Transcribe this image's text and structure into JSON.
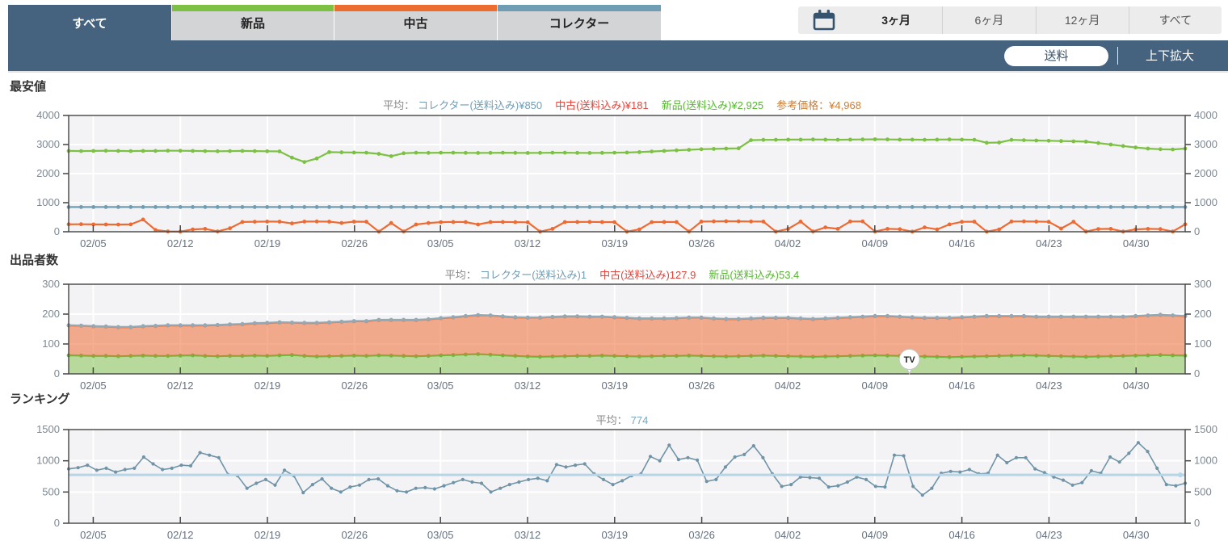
{
  "tabs": {
    "items": [
      {
        "label": "すべて",
        "selected": true,
        "stripe": ""
      },
      {
        "label": "新品",
        "selected": false,
        "stripe": "#7CC144"
      },
      {
        "label": "中古",
        "selected": false,
        "stripe": "#ED6C30"
      },
      {
        "label": "コレクター",
        "selected": false,
        "stripe": "#6F9DB4"
      }
    ]
  },
  "range_bar": {
    "calendar_icon": "calendar-icon",
    "items": [
      {
        "label": "3ヶ月",
        "selected": true
      },
      {
        "label": "6ヶ月",
        "selected": false
      },
      {
        "label": "12ヶ月",
        "selected": false
      },
      {
        "label": "すべて",
        "selected": false
      }
    ]
  },
  "toolbar": {
    "shipping_label": "送料",
    "expand_label": "上下拡大"
  },
  "colors": {
    "header": "#45637F",
    "new": "#7CC144",
    "used": "#ED6B33",
    "collector": "#6F9DB4",
    "ranking": "#7094A7",
    "avg_line": "#B5D6E8",
    "plot_bg": "#f3f3f5"
  },
  "sections": [
    {
      "title": "最安値",
      "avg": {
        "prefix": "平均：",
        "segments": [
          {
            "text": "コレクター(送料込み)¥850",
            "color": "#6F9DB4"
          },
          {
            "text": "中古(送料込み)¥181",
            "color": "#E2453C"
          },
          {
            "text": "新品(送料込み)¥2,925",
            "color": "#55B82E"
          },
          {
            "text": "参考価格：¥4,968",
            "color": "#C9803E"
          }
        ]
      }
    },
    {
      "title": "出品者数",
      "avg": {
        "prefix": "平均：",
        "segments": [
          {
            "text": "コレクター(送料込み)1",
            "color": "#6F9DB4"
          },
          {
            "text": "中古(送料込み)127.9",
            "color": "#E2453C"
          },
          {
            "text": "新品(送料込み)53.4",
            "color": "#55B82E"
          }
        ]
      }
    },
    {
      "title": "ランキング",
      "avg": {
        "prefix": "平均：",
        "segments": [
          {
            "text": "774",
            "color": "#7BA7C0"
          }
        ]
      }
    }
  ],
  "x_ticks": [
    {
      "label": "02/05",
      "f": 0.022
    },
    {
      "label": "02/12",
      "f": 0.1
    },
    {
      "label": "02/19",
      "f": 0.178
    },
    {
      "label": "02/26",
      "f": 0.256
    },
    {
      "label": "03/05",
      "f": 0.333
    },
    {
      "label": "03/12",
      "f": 0.411
    },
    {
      "label": "03/19",
      "f": 0.489
    },
    {
      "label": "03/26",
      "f": 0.567
    },
    {
      "label": "04/02",
      "f": 0.644
    },
    {
      "label": "04/09",
      "f": 0.722
    },
    {
      "label": "04/16",
      "f": 0.8
    },
    {
      "label": "04/23",
      "f": 0.878
    },
    {
      "label": "04/30",
      "f": 0.956
    }
  ],
  "chart_data": [
    {
      "type": "line",
      "title": "最安値",
      "ymax": 4000,
      "y_ticks": [
        0,
        1000,
        2000,
        3000,
        4000
      ],
      "x_range": [
        "02/03",
        "05/03"
      ],
      "grid": true,
      "series": [
        {
          "name": "新品(送料込み)",
          "color": "#7CC144",
          "values": [
            2780,
            2775,
            2780,
            2785,
            2780,
            2775,
            2780,
            2780,
            2790,
            2785,
            2780,
            2775,
            2770,
            2775,
            2780,
            2775,
            2770,
            2765,
            2550,
            2400,
            2520,
            2740,
            2730,
            2725,
            2720,
            2680,
            2600,
            2700,
            2720,
            2715,
            2720,
            2720,
            2715,
            2710,
            2715,
            2720,
            2715,
            2710,
            2715,
            2720,
            2720,
            2715,
            2710,
            2715,
            2720,
            2725,
            2740,
            2760,
            2780,
            2800,
            2820,
            2840,
            2850,
            2860,
            2870,
            3150,
            3160,
            3165,
            3170,
            3170,
            3175,
            3170,
            3165,
            3170,
            3175,
            3180,
            3175,
            3170,
            3170,
            3165,
            3170,
            3175,
            3170,
            3165,
            3060,
            3070,
            3160,
            3150,
            3140,
            3130,
            3120,
            3110,
            3100,
            3050,
            3000,
            2950,
            2900,
            2860,
            2840,
            2830,
            2860
          ]
        },
        {
          "name": "コレクター(送料込み)",
          "color": "#6F9DB4",
          "constant": 850,
          "points": 91
        },
        {
          "name": "中古(送料込み)",
          "color": "#ED6B33",
          "values": [
            255,
            258,
            252,
            250,
            248,
            252,
            420,
            60,
            10,
            5,
            80,
            100,
            10,
            120,
            335,
            345,
            350,
            348,
            285,
            350,
            352,
            348,
            300,
            348,
            345,
            5,
            300,
            10,
            250,
            300,
            330,
            335,
            332,
            250,
            332,
            336,
            330,
            325,
            5,
            100,
            332,
            336,
            340,
            334,
            330,
            5,
            80,
            330,
            336,
            332,
            8,
            350,
            356,
            360,
            358,
            354,
            350,
            5,
            100,
            350,
            10,
            150,
            100,
            352,
            356,
            8,
            100,
            90,
            5,
            150,
            80,
            252,
            342,
            346,
            5,
            80,
            352,
            356,
            350,
            342,
            110,
            345,
            8,
            95,
            100,
            8,
            80,
            100,
            92,
            8,
            255
          ]
        }
      ]
    },
    {
      "type": "stacked-area",
      "title": "出品者数",
      "ymax": 300,
      "y_ticks": [
        0,
        100,
        200,
        300
      ],
      "x_range": [
        "02/03",
        "05/03"
      ],
      "grid": true,
      "marker": {
        "label": "TV",
        "f": 0.753,
        "value": 62
      },
      "series": [
        {
          "name": "新品(送料込み)",
          "color": "#6DBB3C",
          "fill": "rgba(124,193,68,0.5)",
          "stacked": true,
          "values": [
            62,
            61,
            60,
            60,
            59,
            60,
            61,
            60,
            60,
            61,
            62,
            60,
            59,
            60,
            60,
            61,
            60,
            62,
            63,
            60,
            58,
            59,
            60,
            61,
            60,
            62,
            61,
            60,
            59,
            60,
            62,
            63,
            65,
            66,
            64,
            62,
            60,
            58,
            57,
            58,
            59,
            60,
            60,
            61,
            60,
            59,
            58,
            59,
            60,
            60,
            61,
            60,
            59,
            58,
            59,
            60,
            61,
            60,
            59,
            58,
            57,
            58,
            59,
            60,
            61,
            62,
            61,
            60,
            59,
            58,
            57,
            56,
            57,
            58,
            59,
            60,
            61,
            62,
            61,
            60,
            59,
            58,
            57,
            58,
            59,
            60,
            61,
            62,
            63,
            62,
            61
          ]
        },
        {
          "name": "中古(送料込み)",
          "color": "#ED6B33",
          "fill": "rgba(237,107,51,0.55)",
          "stacked": true,
          "values": [
            100,
            100,
            99,
            98,
            97,
            96,
            98,
            100,
            102,
            101,
            100,
            102,
            104,
            105,
            106,
            108,
            110,
            110,
            108,
            110,
            112,
            113,
            114,
            115,
            116,
            118,
            119,
            120,
            121,
            122,
            124,
            126,
            128,
            130,
            131,
            130,
            129,
            130,
            131,
            132,
            133,
            132,
            131,
            130,
            129,
            128,
            127,
            126,
            125,
            126,
            127,
            128,
            126,
            125,
            124,
            125,
            126,
            127,
            128,
            127,
            126,
            127,
            128,
            129,
            130,
            131,
            132,
            131,
            130,
            129,
            130,
            131,
            132,
            133,
            134,
            133,
            132,
            131,
            130,
            131,
            132,
            133,
            134,
            133,
            132,
            131,
            132,
            133,
            134,
            133,
            132
          ]
        },
        {
          "name": "コレクター(送料込み)",
          "color": "#93A9B6",
          "stacked": true,
          "constant": 1,
          "points": 91,
          "line_only": true
        }
      ]
    },
    {
      "type": "line",
      "title": "ランキング",
      "ymax": 1500,
      "y_ticks": [
        0,
        500,
        1000,
        1500
      ],
      "x_range": [
        "02/03",
        "05/03"
      ],
      "grid": true,
      "series": [
        {
          "name": "ランキング",
          "color": "#7094A7",
          "width": 1.6,
          "dot_r": 2.1,
          "values": [
            870,
            890,
            930,
            850,
            880,
            820,
            860,
            880,
            1060,
            950,
            860,
            880,
            930,
            920,
            1130,
            1090,
            1050,
            780,
            760,
            560,
            640,
            700,
            610,
            850,
            760,
            490,
            620,
            710,
            560,
            500,
            580,
            610,
            700,
            710,
            600,
            520,
            500,
            560,
            570,
            550,
            600,
            650,
            700,
            660,
            640,
            500,
            560,
            620,
            660,
            700,
            720,
            680,
            940,
            900,
            930,
            950,
            790,
            700,
            620,
            680,
            760,
            790,
            1070,
            1000,
            1250,
            1020,
            1050,
            1010,
            670,
            700,
            900,
            1060,
            1100,
            1240,
            1050,
            790,
            590,
            620,
            740,
            730,
            720,
            580,
            600,
            660,
            740,
            700,
            590,
            580,
            1090,
            1080,
            590,
            450,
            560,
            800,
            830,
            820,
            860,
            790,
            800,
            1090,
            970,
            1050,
            1050,
            870,
            810,
            740,
            690,
            610,
            650,
            840,
            800,
            1060,
            980,
            1120,
            1290,
            1150,
            880,
            620,
            600,
            640
          ]
        },
        {
          "name": "平均",
          "color": "#B5D6E8",
          "avg_line": 774,
          "width": 3
        }
      ]
    }
  ]
}
